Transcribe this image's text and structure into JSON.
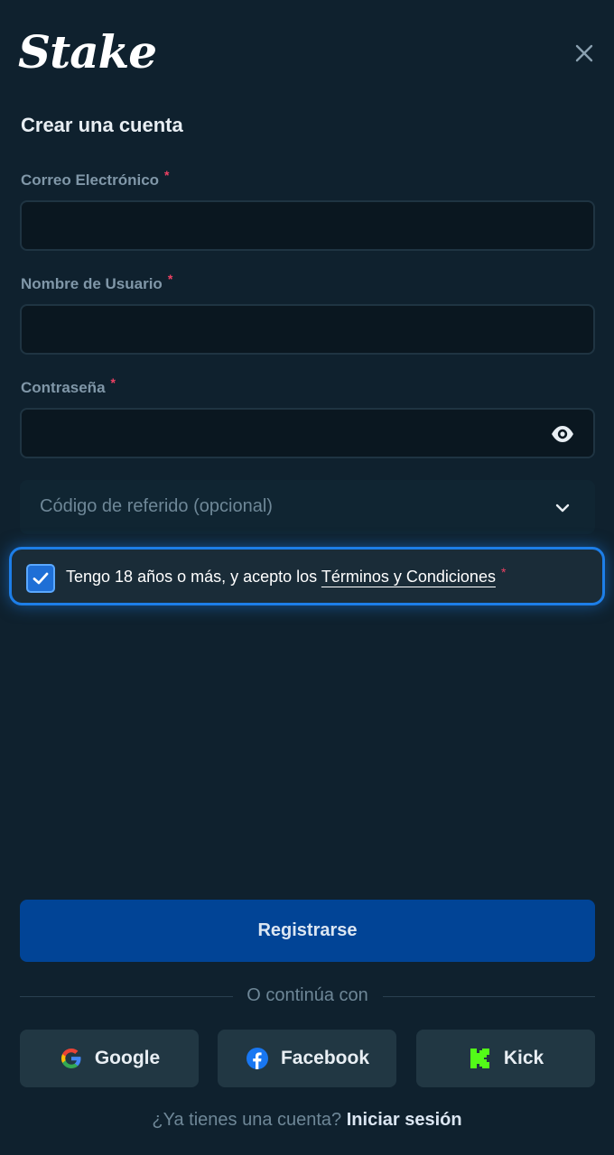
{
  "brand": {
    "logo_text": "Stake"
  },
  "modal": {
    "title": "Crear una cuenta",
    "close_icon": "close-icon"
  },
  "form": {
    "email": {
      "label": "Correo Electrónico",
      "required_mark": "*",
      "value": "",
      "placeholder": ""
    },
    "username": {
      "label": "Nombre de Usuario",
      "required_mark": "*",
      "value": "",
      "placeholder": ""
    },
    "password": {
      "label": "Contraseña",
      "required_mark": "*",
      "value": "",
      "placeholder": "",
      "toggle_icon": "eye-icon"
    },
    "referral": {
      "label": "Código de referido (opcional)",
      "expand_icon": "chevron-down-icon"
    },
    "terms": {
      "checked": true,
      "text": "Tengo 18 años o más, y acepto los",
      "link": "Términos y Condiciones",
      "required_mark": "*"
    },
    "submit_label": "Registrarse"
  },
  "social": {
    "divider_text": "O continúa con",
    "providers": [
      {
        "label": "Google",
        "icon": "google-icon"
      },
      {
        "label": "Facebook",
        "icon": "facebook-icon"
      },
      {
        "label": "Kick",
        "icon": "kick-icon"
      }
    ]
  },
  "footer": {
    "question": "¿Ya tienes una cuenta?",
    "signin_label": "Iniciar sesión"
  },
  "colors": {
    "background": "#0f212e",
    "input_bg": "#0a1720",
    "primary_button": "#014496",
    "checkbox_accent": "#1d7ee8",
    "required": "#ed4163",
    "kick_green": "#53fc18"
  }
}
